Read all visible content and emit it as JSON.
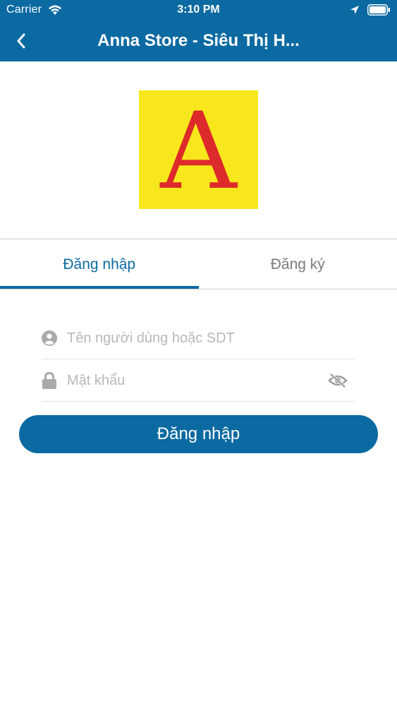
{
  "status_bar": {
    "carrier": "Carrier",
    "time": "3:10 PM",
    "icons": [
      "wifi-icon",
      "location-arrow-icon",
      "battery-icon"
    ]
  },
  "nav": {
    "title": "Anna Store - Siêu Thị H...",
    "back_icon": "chevron-left-icon"
  },
  "logo": {
    "letter": "A",
    "background": "#f8e71c",
    "letter_color": "#dd2a2a"
  },
  "tabs": [
    {
      "label": "Đăng nhập",
      "active": true
    },
    {
      "label": "Đăng ký",
      "active": false
    }
  ],
  "form": {
    "username": {
      "placeholder": "Tên người dùng hoặc SDT",
      "value": "",
      "icon": "user-circle-icon"
    },
    "password": {
      "placeholder": "Mật khẩu",
      "value": "",
      "icon": "lock-icon",
      "toggle_icon": "eye-slash-icon"
    },
    "submit_label": "Đăng nhập"
  },
  "colors": {
    "primary": "#0b6aa2",
    "placeholder": "#b8b8b8",
    "inactive_tab": "#7a7a7a"
  }
}
